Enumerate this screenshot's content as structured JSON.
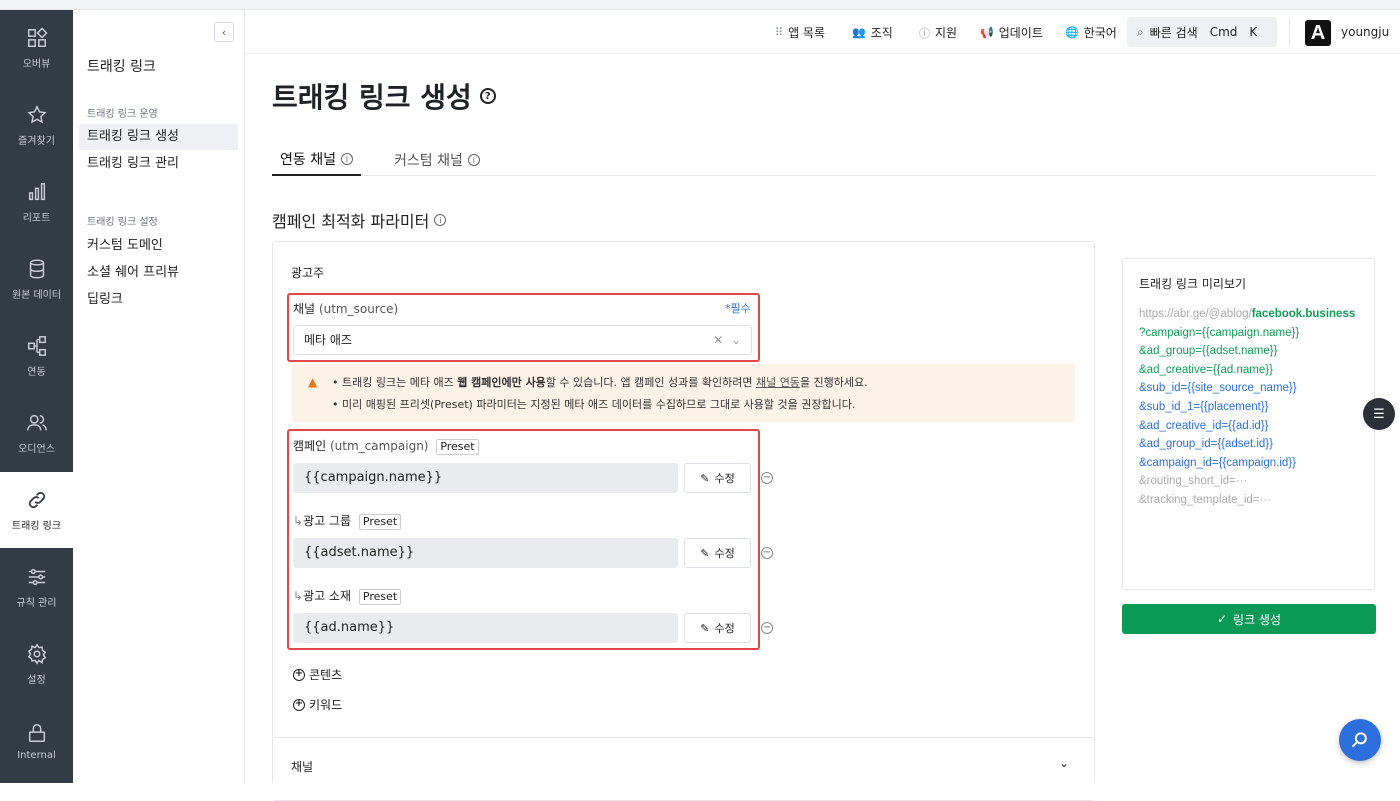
{
  "rail": {
    "items": [
      {
        "label": "오버뷰",
        "icon": "overview-icon"
      },
      {
        "label": "즐겨찾기",
        "icon": "star-icon"
      },
      {
        "label": "리포트",
        "icon": "bar-chart-icon"
      },
      {
        "label": "원본 데이터",
        "icon": "database-icon"
      },
      {
        "label": "연동",
        "icon": "integration-icon"
      },
      {
        "label": "오디언스",
        "icon": "audience-icon"
      },
      {
        "label": "트래킹 링크",
        "icon": "link-icon"
      },
      {
        "label": "규칙 관리",
        "icon": "sliders-icon"
      },
      {
        "label": "설정",
        "icon": "gear-icon"
      },
      {
        "label": "Internal",
        "icon": "lock-icon"
      }
    ],
    "active_index": 6,
    "color": "#333b45"
  },
  "subnav": {
    "collapse": "‹",
    "title": "트래킹 링크",
    "groups": [
      {
        "label": "트래킹 링크 운영",
        "items": [
          "트래킹 링크 생성",
          "트래킹 링크 관리"
        ]
      },
      {
        "label": "트래킹 링크 설정",
        "items": [
          "커스텀 도메인",
          "소셜 쉐어 프리뷰",
          "딥링크"
        ]
      }
    ]
  },
  "header": {
    "app_list": "앱 목록",
    "org": "조직",
    "support": "지원",
    "updates": "업데이트",
    "language": "한국어",
    "search": "빠른 검색",
    "shortcut_cmd": "Cmd",
    "shortcut_key": "K",
    "avatar_letter": "A",
    "username": "youngju"
  },
  "page": {
    "title": "트래킹 링크 생성",
    "tabs": [
      "연동 채널",
      "커스텀 채널"
    ],
    "section_title": "캠페인 최적화 파라미터"
  },
  "form": {
    "advertiser_label": "광고주",
    "channel_label": "채널",
    "channel_param": "(utm_source)",
    "required": "*필수",
    "channel_value": "메타 애즈",
    "warning": {
      "line1_pre": "트래킹 링크는 메타 애즈 ",
      "line1_bold": "웹 캠페인에만 사용",
      "line1_mid": "할 수 있습니다. 앱 캠페인 성과를 확인하려면 ",
      "line1_link": "채널 연동",
      "line1_post": "을 진행하세요.",
      "line2": "미리 매핑된 프리셋(Preset) 파라미터는 지정된 메타 애즈 데이터를 수집하므로 그대로 사용할 것을 권장합니다."
    },
    "campaign_label": "캠페인",
    "campaign_param": "(utm_campaign)",
    "preset": "Preset",
    "campaign_value": "{{campaign.name}}",
    "adgroup_label": "광고 그룹",
    "adgroup_value": "{{adset.name}}",
    "creative_label": "광고 소재",
    "creative_value": "{{ad.name}}",
    "edit": "수정",
    "add_content": "콘텐츠",
    "add_keyword": "키워드",
    "channel_section": "채널"
  },
  "preview": {
    "title": "트래킹 링크 미리보기",
    "base": "https://abr.ge/@ablog/",
    "source": "facebook.business",
    "green_params": [
      "?campaign={{campaign.name}}",
      "&ad_group={{adset.name}}",
      "&ad_creative={{ad.name}}"
    ],
    "blue_params": [
      "&sub_id={{site_source_name}}",
      "&sub_id_1={{placement}}",
      "&ad_creative_id={{ad.id}}",
      "&ad_group_id={{adset.id}}",
      "&campaign_id={{campaign.id}}"
    ],
    "gray_params": [
      "&routing_short_id=···",
      "&tracking_template_id=···"
    ],
    "create_button": "링크 생성"
  },
  "colors": {
    "accent_green": "#0b9a55",
    "link_blue": "#2a6fdb",
    "highlight_red": "#e0474c",
    "warning_bg": "#fdf2e8"
  }
}
